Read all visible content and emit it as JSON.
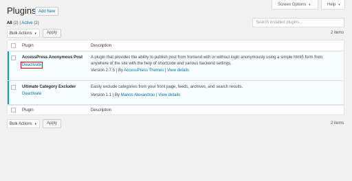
{
  "header": {
    "title": "Plugins",
    "add_new_label": "Add New",
    "screen_options_label": "Screen Options",
    "help_label": "Help"
  },
  "filters": {
    "all_label": "All",
    "all_count": "(2)",
    "separator": "|",
    "active_label": "Active",
    "active_count": "(2)"
  },
  "search": {
    "placeholder": "Search installed plugins..."
  },
  "top_nav": {
    "bulk_actions": "Bulk Actions",
    "apply": "Apply",
    "items_count": "2 items"
  },
  "bottom_nav": {
    "bulk_actions": "Bulk Actions",
    "apply": "Apply",
    "items_count": "2 items"
  },
  "table": {
    "columns": {
      "plugin": "Plugin",
      "description": "Description"
    },
    "rows": [
      {
        "name": "AccessPress Anonymous Post",
        "action": "Deactivate",
        "description": "A plugin that provides the ability to publish post from frontend with or without login anonymously using a simple html5 form from anywhere of the site with the help of shortcode and various backend settings.",
        "version": "Version 2.7.5",
        "by": "By",
        "author": "AccessPress Themes",
        "view_details": "View details"
      },
      {
        "name": "Ultimate Category Excluder",
        "action": "Deactivate",
        "description": "Easily exclude categories from your front page, feeds, archives, and search results.",
        "version": "Version 1.1",
        "by": "By",
        "author": "Marios Alexandrou",
        "view_details": "View details"
      }
    ]
  },
  "colors": {
    "accent": "#00a0d2",
    "link": "#0073aa",
    "highlight_box": "#dd0000"
  }
}
